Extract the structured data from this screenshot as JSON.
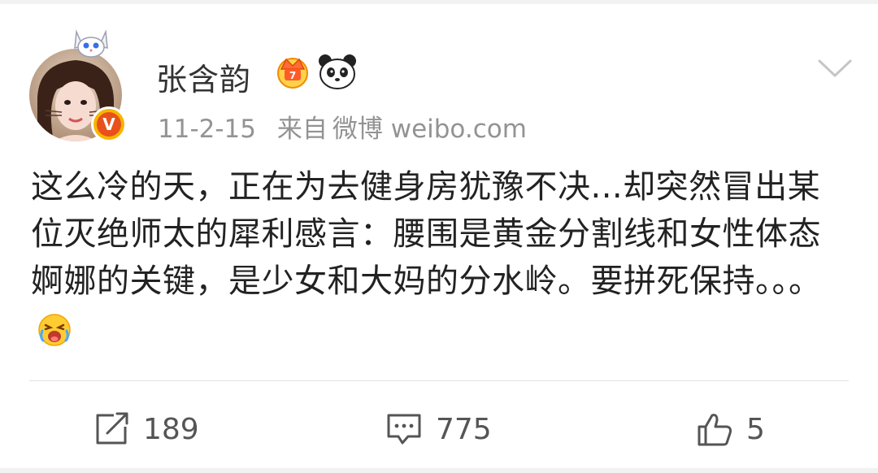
{
  "header": {
    "username": "张含韵",
    "timestamp": "11-2-15",
    "source_prefix": "来自",
    "source": "微博 weibo.com",
    "verified_badge": "V",
    "icons": [
      "avatar",
      "cat-ears-icon",
      "verified-badge-icon",
      "vip-crown-icon",
      "panda-icon",
      "chevron-down-icon"
    ]
  },
  "post": {
    "text": "这么冷的天，正在为去健身房犹豫不决...却突然冒出某位灭绝师太的犀利感言：腰围是黄金分割线和女性体态婀娜的关键，是少女和大妈的分水岭。要拼死保持。。。",
    "emoji": "crying-face-icon"
  },
  "actions": {
    "repost_count": "189",
    "comment_count": "775",
    "like_count": "5"
  },
  "colors": {
    "text": "#222222",
    "meta": "#939393",
    "badge_orange": "#f7b500",
    "badge_red": "#e8511b",
    "background": "#f2f2f2"
  }
}
